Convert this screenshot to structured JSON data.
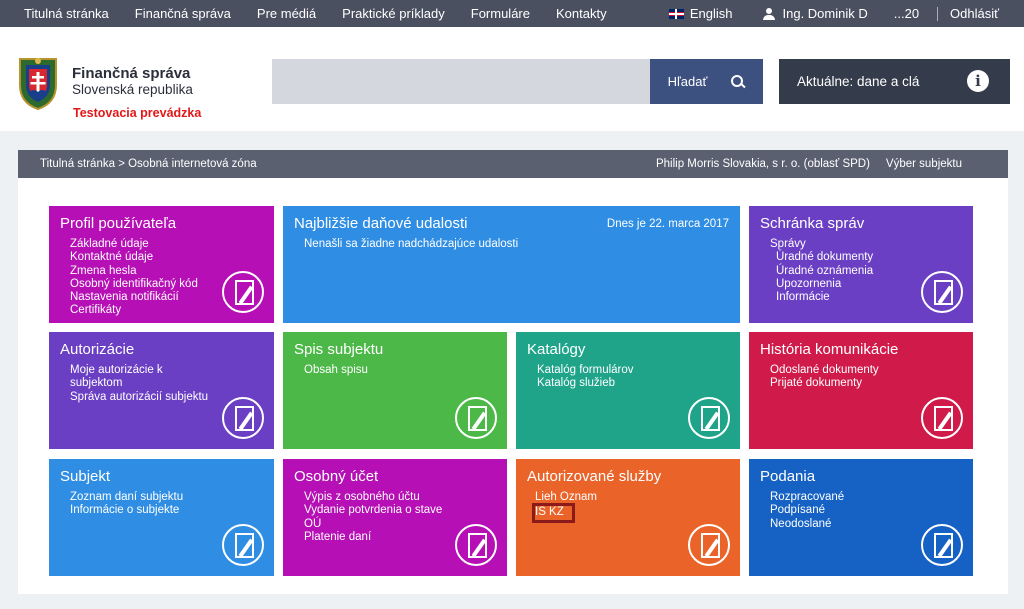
{
  "topnav": {
    "items": [
      "Titulná stránka",
      "Finančná správa",
      "Pre médiá",
      "Praktické príklady",
      "Formuláre",
      "Kontakty"
    ],
    "language": "English",
    "user": "Ing. Dominik D",
    "session": "...20",
    "logout": "Odhlásiť"
  },
  "header": {
    "brand_title": "Finančná správa",
    "brand_subtitle": "Slovenská republika",
    "brand_env": "Testovacia prevádzka",
    "search_placeholder": "",
    "search_button": "Hľadať",
    "news_button": "Aktuálne: dane a clá"
  },
  "breadcrumb": {
    "home": "Titulná stránka",
    "separator": " > ",
    "current": "Osobná internetová zóna",
    "subject": "Philip Morris Slovakia, s r. o. (oblasť SPD)",
    "select_subject": "Výber subjektu"
  },
  "tiles": {
    "profil": {
      "title": "Profil používateľa",
      "color": "#b50fb5",
      "items": [
        "Základné údaje",
        "Kontaktné údaje",
        "Zmena hesla",
        "Osobný identifikačný kód",
        "Nastavenia notifikácií",
        "Certifikáty"
      ]
    },
    "udalosti": {
      "title": "Najbližšie daňové udalosti",
      "color": "#2f8ee3",
      "date": "Dnes je 22. marca 2017",
      "items": [
        "Nenašli sa žiadne nadchádzajúce udalosti"
      ]
    },
    "schranka": {
      "title": "Schránka správ",
      "color": "#6b3fc4",
      "items": [
        "Správy",
        "Úradné dokumenty",
        "Úradné oznámenia",
        "Upozornenia",
        "Informácie"
      ]
    },
    "autorizacie": {
      "title": "Autorizácie",
      "color": "#6b3fc4",
      "items": [
        "Moje autorizácie k",
        "subjektom",
        "Správa autorizácií subjektu"
      ]
    },
    "spis": {
      "title": "Spis subjektu",
      "color": "#4cb848",
      "items": [
        "Obsah spisu"
      ]
    },
    "katalogy": {
      "title": "Katalógy",
      "color": "#1fa48a",
      "items": [
        "Katalóg formulárov",
        "Katalóg služieb"
      ]
    },
    "historia": {
      "title": "História komunikácie",
      "color": "#d01b4a",
      "items": [
        "Odoslané dokumenty",
        "Prijaté dokumenty"
      ]
    },
    "subjekt": {
      "title": "Subjekt",
      "color": "#2f8ee3",
      "items": [
        "Zoznam daní subjektu",
        "Informácie o subjekte"
      ]
    },
    "ucet": {
      "title": "Osobný účet",
      "color": "#b50fb5",
      "items": [
        "Výpis z osobného účtu",
        "Vydanie potvrdenia o stave",
        "OÚ",
        "Platenie daní"
      ]
    },
    "sluzby": {
      "title": "Autorizované služby",
      "color": "#ea6429",
      "items": [
        "Lieh Oznam",
        "IS KZ"
      ]
    },
    "podania": {
      "title": "Podania",
      "color": "#1661c4",
      "items": [
        "Rozpracované",
        "Podpísané",
        "Neodoslané"
      ]
    }
  }
}
